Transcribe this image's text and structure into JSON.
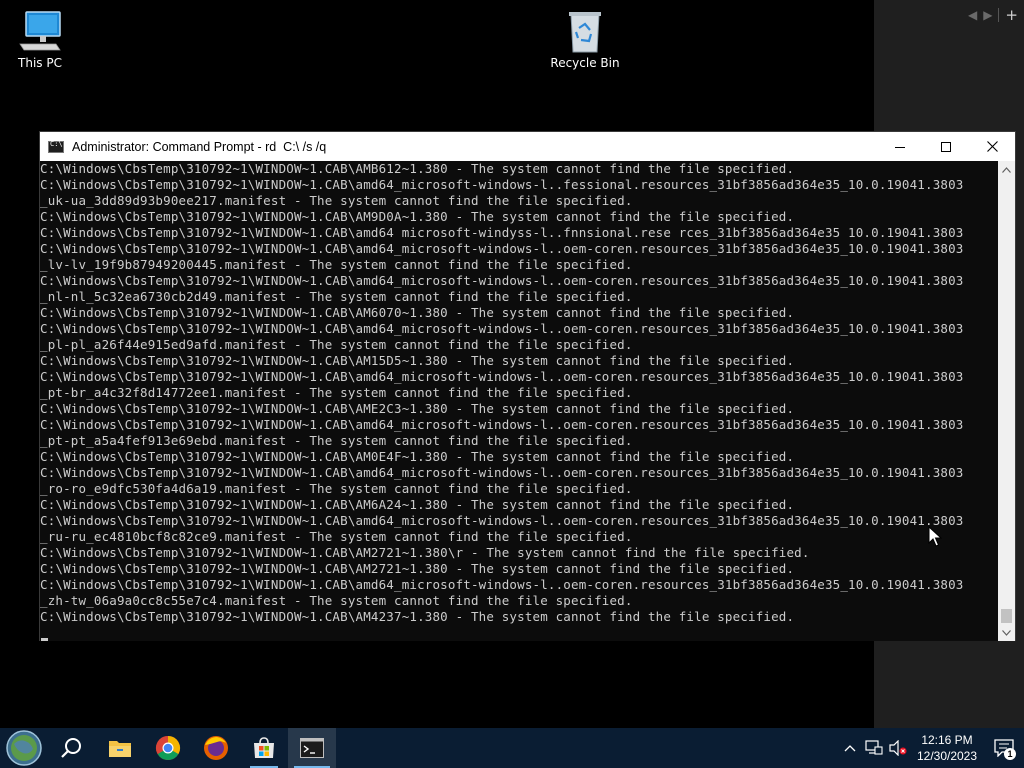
{
  "desktop": {
    "icons": [
      {
        "label": "This PC"
      },
      {
        "label": "Recycle Bin"
      }
    ],
    "right_panel": {
      "nav_prev": "◀",
      "nav_next": "▶",
      "add": "+"
    }
  },
  "cmd_window": {
    "title": "Administrator: Command Prompt - rd  C:\\ /s /q",
    "controls": {
      "minimize": "minimize",
      "maximize": "maximize",
      "close": "close"
    },
    "lines": [
      "C:\\Windows\\CbsTemp\\310792~1\\WINDOW~1.CAB\\AMB612~1.380 - The system cannot find the file specified.",
      "C:\\Windows\\CbsTemp\\310792~1\\WINDOW~1.CAB\\amd64_microsoft-windows-l..fessional.resources_31bf3856ad364e35_10.0.19041.3803",
      "_uk-ua_3dd89d93b90ee217.manifest - The system cannot find the file specified.",
      "C:\\Windows\\CbsTemp\\310792~1\\WINDOW~1.CAB\\AM9D0A~1.380 - The system cannot find the file specified.",
      "C:\\Windows\\CbsTemp\\310792~1\\WINDOW~1.CAB\\amd64 microsoft-windyss-l..fnnsional.rese rces_31bf3856ad364e35 10.0.19041.3803",
      "C:\\Windows\\CbsTemp\\310792~1\\WINDOW~1.CAB\\amd64_microsoft-windows-l..oem-coren.resources_31bf3856ad364e35_10.0.19041.3803",
      "_lv-lv_19f9b87949200445.manifest - The system cannot find the file specified.",
      "C:\\Windows\\CbsTemp\\310792~1\\WINDOW~1.CAB\\amd64_microsoft-windows-l..oem-coren.resources_31bf3856ad364e35_10.0.19041.3803",
      "_nl-nl_5c32ea6730cb2d49.manifest - The system cannot find the file specified.",
      "C:\\Windows\\CbsTemp\\310792~1\\WINDOW~1.CAB\\AM6070~1.380 - The system cannot find the file specified.",
      "C:\\Windows\\CbsTemp\\310792~1\\WINDOW~1.CAB\\amd64_microsoft-windows-l..oem-coren.resources_31bf3856ad364e35_10.0.19041.3803",
      "_pl-pl_a26f44e915ed9afd.manifest - The system cannot find the file specified.",
      "C:\\Windows\\CbsTemp\\310792~1\\WINDOW~1.CAB\\AM15D5~1.380 - The system cannot find the file specified.",
      "C:\\Windows\\CbsTemp\\310792~1\\WINDOW~1.CAB\\amd64_microsoft-windows-l..oem-coren.resources_31bf3856ad364e35_10.0.19041.3803",
      "_pt-br_a4c32f8d14772ee1.manifest - The system cannot find the file specified.",
      "C:\\Windows\\CbsTemp\\310792~1\\WINDOW~1.CAB\\AME2C3~1.380 - The system cannot find the file specified.",
      "C:\\Windows\\CbsTemp\\310792~1\\WINDOW~1.CAB\\amd64_microsoft-windows-l..oem-coren.resources_31bf3856ad364e35_10.0.19041.3803",
      "_pt-pt_a5a4fef913e69ebd.manifest - The system cannot find the file specified.",
      "C:\\Windows\\CbsTemp\\310792~1\\WINDOW~1.CAB\\AM0E4F~1.380 - The system cannot find the file specified.",
      "C:\\Windows\\CbsTemp\\310792~1\\WINDOW~1.CAB\\amd64_microsoft-windows-l..oem-coren.resources_31bf3856ad364e35_10.0.19041.3803",
      "_ro-ro_e9dfc530fa4d6a19.manifest - The system cannot find the file specified.",
      "C:\\Windows\\CbsTemp\\310792~1\\WINDOW~1.CAB\\AM6A24~1.380 - The system cannot find the file specified.",
      "C:\\Windows\\CbsTemp\\310792~1\\WINDOW~1.CAB\\amd64_microsoft-windows-l..oem-coren.resources_31bf3856ad364e35_10.0.19041.3803",
      "_ru-ru_ec4810bcf8c82ce9.manifest - The system cannot find the file specified.",
      "C:\\Windows\\CbsTemp\\310792~1\\WINDOW~1.CAB\\AM2721~1.380\\r - The system cannot find the file specified.",
      "C:\\Windows\\CbsTemp\\310792~1\\WINDOW~1.CAB\\AM2721~1.380 - The system cannot find the file specified.",
      "C:\\Windows\\CbsTemp\\310792~1\\WINDOW~1.CAB\\amd64_microsoft-windows-l..oem-coren.resources_31bf3856ad364e35_10.0.19041.3803",
      "_zh-tw_06a9a0cc8c55e7c4.manifest - The system cannot find the file specified.",
      "C:\\Windows\\CbsTemp\\310792~1\\WINDOW~1.CAB\\AM4237~1.380 - The system cannot find the file specified.",
      ""
    ]
  },
  "taskbar": {
    "items": [
      {
        "name": "start-button",
        "icon": "globe-icon"
      },
      {
        "name": "search-button",
        "icon": "search-icon"
      },
      {
        "name": "file-explorer-button",
        "icon": "folder-icon"
      },
      {
        "name": "chrome-button",
        "icon": "chrome-icon"
      },
      {
        "name": "firefox-button",
        "icon": "firefox-icon"
      },
      {
        "name": "store-button",
        "icon": "store-icon"
      },
      {
        "name": "cmd-taskbar-button",
        "icon": "cmd-icon"
      }
    ],
    "clock": {
      "time": "12:16 PM",
      "date": "12/30/2023"
    },
    "notification_count": "1"
  },
  "colors": {
    "console_bg": "#0c0c0c",
    "console_text": "#cccccc",
    "taskbar_bg": "#0a1d33",
    "accent": "#76b9ed"
  }
}
